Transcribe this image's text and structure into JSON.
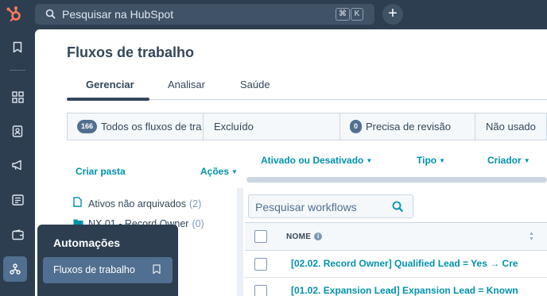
{
  "search": {
    "placeholder": "Pesquisar na HubSpot",
    "shortcut_keys": [
      "⌘",
      "K"
    ]
  },
  "header": {
    "add_symbol": "+"
  },
  "rail": {
    "icons": [
      "bookmark-icon",
      "grid-icon",
      "contacts-icon",
      "megaphone-icon",
      "newspaper-icon",
      "wallet-icon",
      "workflow-icon"
    ]
  },
  "page": {
    "title": "Fluxos de trabalho"
  },
  "tabs": [
    {
      "label": "Gerenciar",
      "active": true
    },
    {
      "label": "Analisar",
      "active": false
    },
    {
      "label": "Saúde",
      "active": false
    }
  ],
  "filters": [
    {
      "count": "166",
      "label": "Todos os fluxos de tra"
    },
    {
      "count": "",
      "label": "Excluído"
    },
    {
      "count": "0",
      "label": "Precisa de revisão"
    },
    {
      "count": "",
      "label": "Não usado"
    }
  ],
  "folders_panel": {
    "create_folder": "Criar pasta",
    "actions": "Ações",
    "items": [
      {
        "name": "Ativos não arquivados",
        "count": "(2)"
      },
      {
        "name": "NX 01 - Record Owner",
        "count": "(0)"
      }
    ]
  },
  "columns_filters": {
    "status": "Ativado ou Desativado",
    "type": "Tipo",
    "creator": "Criador"
  },
  "workflow_search": {
    "placeholder": "Pesquisar workflows"
  },
  "table": {
    "name_header": "NOME",
    "rows": [
      {
        "name": "[02.02. Record Owner] Qualified Lead = Yes → Cre"
      },
      {
        "name": "[01.02. Expansion Lead] Expansion Lead = Known"
      }
    ]
  },
  "flyout": {
    "heading": "Automações",
    "item": "Fluxos de trabalho"
  },
  "colors": {
    "nav_bg": "#2d3e50",
    "nav_active": "#516f90",
    "link": "#0091ae",
    "text": "#33475b",
    "logo": "#ff7a59"
  }
}
